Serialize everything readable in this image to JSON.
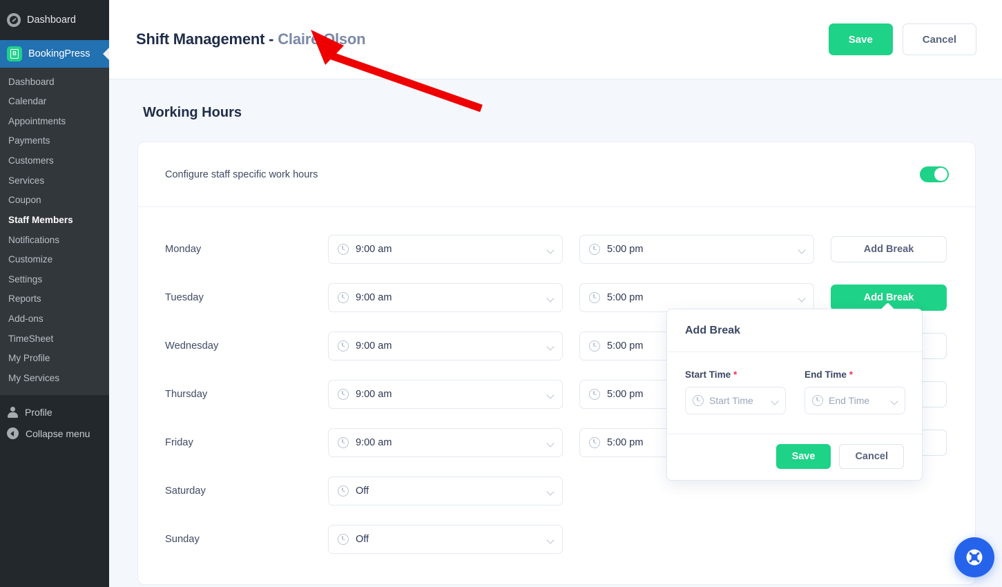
{
  "wp_sidebar": {
    "top_item": {
      "label": "Dashboard",
      "icon": "dashboard-icon"
    },
    "brand": {
      "label": "BookingPress",
      "icon": "bookingpress-logo-icon",
      "mark": "B"
    },
    "submenu": [
      {
        "label": "Dashboard",
        "active": false
      },
      {
        "label": "Calendar",
        "active": false
      },
      {
        "label": "Appointments",
        "active": false
      },
      {
        "label": "Payments",
        "active": false
      },
      {
        "label": "Customers",
        "active": false
      },
      {
        "label": "Services",
        "active": false
      },
      {
        "label": "Coupon",
        "active": false
      },
      {
        "label": "Staff Members",
        "active": true
      },
      {
        "label": "Notifications",
        "active": false
      },
      {
        "label": "Customize",
        "active": false
      },
      {
        "label": "Settings",
        "active": false
      },
      {
        "label": "Reports",
        "active": false
      },
      {
        "label": "Add-ons",
        "active": false
      },
      {
        "label": "TimeSheet",
        "active": false
      },
      {
        "label": "My Profile",
        "active": false
      },
      {
        "label": "My Services",
        "active": false
      }
    ],
    "bottom": [
      {
        "label": "Profile",
        "icon": "person-icon"
      },
      {
        "label": "Collapse menu",
        "icon": "collapse-arrow-icon"
      }
    ]
  },
  "header": {
    "title": "Shift Management",
    "separator": " - ",
    "staff_name": "Claire Olson",
    "save_label": "Save",
    "cancel_label": "Cancel"
  },
  "section": {
    "title": "Working Hours",
    "configure_label": "Configure staff specific work hours",
    "toggle_state": "on"
  },
  "schedule": {
    "add_break_label": "Add Break",
    "rows": [
      {
        "day": "Monday",
        "start": "9:00 am",
        "end": "5:00 pm",
        "has_end": true,
        "break_active": false
      },
      {
        "day": "Tuesday",
        "start": "9:00 am",
        "end": "5:00 pm",
        "has_end": true,
        "break_active": true
      },
      {
        "day": "Wednesday",
        "start": "9:00 am",
        "end": "5:00 pm",
        "has_end": true,
        "break_active": false
      },
      {
        "day": "Thursday",
        "start": "9:00 am",
        "end": "5:00 pm",
        "has_end": true,
        "break_active": false
      },
      {
        "day": "Friday",
        "start": "9:00 am",
        "end": "5:00 pm",
        "has_end": true,
        "break_active": false
      },
      {
        "day": "Saturday",
        "start": "Off",
        "end": "",
        "has_end": false,
        "break_active": false
      },
      {
        "day": "Sunday",
        "start": "Off",
        "end": "",
        "has_end": false,
        "break_active": false
      }
    ]
  },
  "popup": {
    "title": "Add Break",
    "start_label": "Start Time",
    "start_required": "*",
    "start_value": "Start Time",
    "end_label": "End Time",
    "end_required": "*",
    "end_value": "End Time",
    "save_label": "Save",
    "cancel_label": "Cancel"
  },
  "help": {
    "icon": "lifebuoy-icon"
  },
  "annotation": {
    "type": "red-arrow",
    "color": "#ef0000"
  },
  "colors": {
    "accent_green": "#1ed287",
    "brand_blue": "#2271b1",
    "help_blue": "#2563eb",
    "required_red": "#f0365b",
    "page_bg": "#f4f7fc",
    "title_navy": "#1f2d4a"
  }
}
